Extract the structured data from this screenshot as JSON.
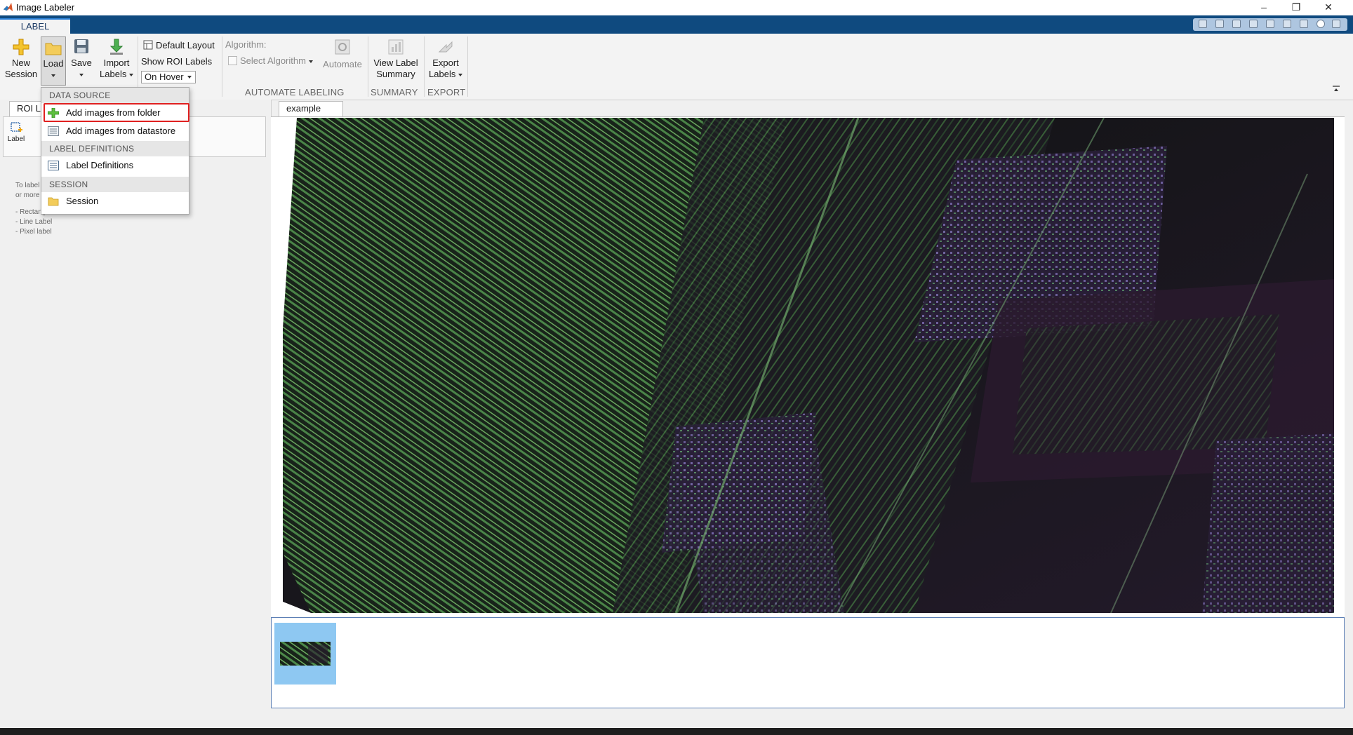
{
  "window": {
    "title": "Image Labeler",
    "controls": [
      "minimize",
      "restore",
      "close"
    ]
  },
  "ribbon": {
    "active_tab": "LABEL",
    "new_session": {
      "line1": "New",
      "line2": "Session"
    },
    "load": {
      "label": "Load"
    },
    "save": {
      "label": "Save"
    },
    "import_labels": {
      "line1": "Import",
      "line2": "Labels"
    },
    "default_layout": "Default Layout",
    "show_roi_labels": "Show ROI Labels",
    "roi_labels_mode": "On Hover",
    "algorithm_label": "Algorithm:",
    "select_algorithm": "Select Algorithm",
    "automate": "Automate",
    "view_label_summary": {
      "line1": "View Label",
      "line2": "Summary"
    },
    "export_labels": {
      "line1": "Export",
      "line2": "Labels"
    },
    "sections": {
      "automate_labeling": "AUTOMATE LABELING",
      "summary": "SUMMARY",
      "export": "EXPORT"
    }
  },
  "load_menu": {
    "data_source_header": "DATA SOURCE",
    "add_from_folder": "Add images from folder",
    "add_from_datastore": "Add images from datastore",
    "label_definitions_header": "LABEL DEFINITIONS",
    "label_definitions": "Label Definitions",
    "session_header": "SESSION",
    "session": "Session"
  },
  "left_panel": {
    "tab": "ROI L",
    "label_button": "Label",
    "hint_line1": "To label",
    "hint_line2": "or more",
    "hint_items": [
      "- Rectangle label",
      "- Line Label",
      "- Pixel label"
    ]
  },
  "document": {
    "tab": "example"
  },
  "colors": {
    "ribbon_bar": "#0f4a7f",
    "highlight_box": "#e02020",
    "thumb_bg": "#8ec8f2"
  }
}
